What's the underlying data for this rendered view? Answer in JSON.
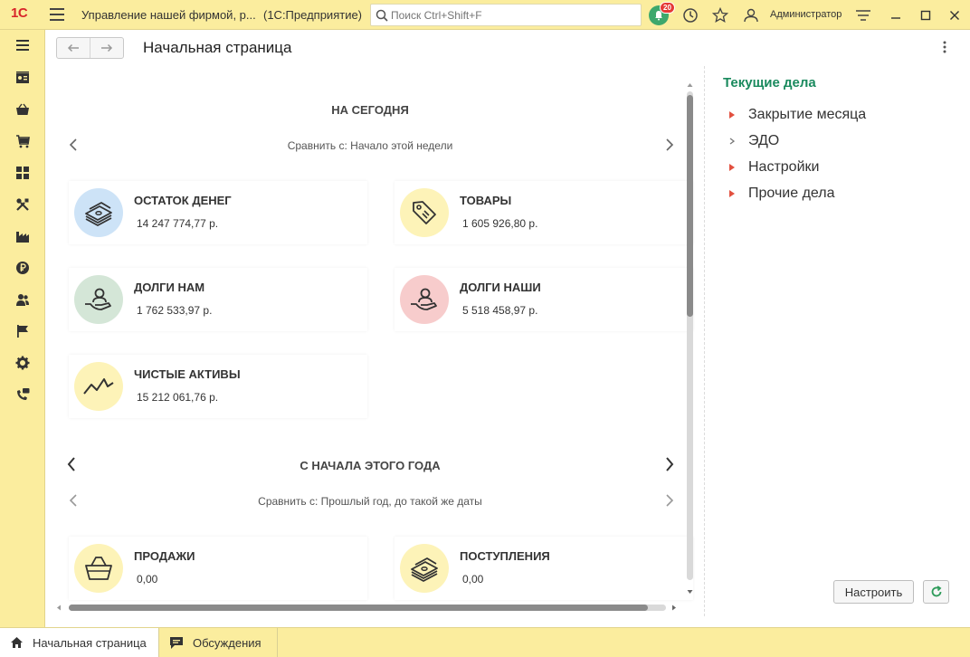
{
  "app": {
    "logo": "1С",
    "title": "Управление нашей фирмой, р...",
    "subtitle": "(1С:Предприятие)",
    "search_placeholder": "Поиск Ctrl+Shift+F",
    "notification_count": "20",
    "user_name": "Администратор"
  },
  "leftnav": {
    "items": [
      {
        "icon": "menu-icon"
      },
      {
        "icon": "crm-card-icon"
      },
      {
        "icon": "basket-icon"
      },
      {
        "icon": "cart-icon"
      },
      {
        "icon": "grid-icon"
      },
      {
        "icon": "tools-icon"
      },
      {
        "icon": "factory-icon"
      },
      {
        "icon": "ruble-icon"
      },
      {
        "icon": "staff-icon"
      },
      {
        "icon": "flag-icon"
      },
      {
        "icon": "gear-icon"
      },
      {
        "icon": "phone-chat-icon"
      }
    ]
  },
  "page": {
    "title": "Начальная страница"
  },
  "today": {
    "header": "НА СЕГОДНЯ",
    "compare": "Сравнить с: Начало этой недели",
    "cards": [
      {
        "title": "ОСТАТОК ДЕНЕГ",
        "value": "14 247 774,77 р.",
        "icon": "money-stack-icon",
        "color": "#cde3f7"
      },
      {
        "title": "ТОВАРЫ",
        "value": "1 605 926,80 р.",
        "icon": "price-tag-icon",
        "color": "#fdf3b8"
      },
      {
        "title": "ДОЛГИ НАМ",
        "value": "1 762 533,97 р.",
        "icon": "hand-person-icon",
        "color": "#d4e6d7"
      },
      {
        "title": "ДОЛГИ НАШИ",
        "value": "5 518 458,97 р.",
        "icon": "hand-person-icon",
        "color": "#f7cccc"
      },
      {
        "title": "ЧИСТЫЕ АКТИВЫ",
        "value": "15 212 061,76 р.",
        "icon": "trend-line-icon",
        "color": "#fdf3b8"
      }
    ]
  },
  "year": {
    "header": "С НАЧАЛА ЭТОГО ГОДА",
    "compare": "Сравнить с: Прошлый год, до такой же даты",
    "cards": [
      {
        "title": "ПРОДАЖИ",
        "value": "0,00",
        "icon": "basket-icon",
        "color": "#fdf3b8"
      },
      {
        "title": "ПОСТУПЛЕНИЯ",
        "value": "0,00",
        "icon": "money-stack-icon",
        "color": "#fdf3b8"
      }
    ]
  },
  "tasks": {
    "title": "Текущие дела",
    "items": [
      {
        "label": "Закрытие месяца",
        "expanded_marker": "red"
      },
      {
        "label": "ЭДО",
        "expanded_marker": "gray"
      },
      {
        "label": "Настройки",
        "expanded_marker": "red"
      },
      {
        "label": "Прочие дела",
        "expanded_marker": "red"
      }
    ],
    "setup_button": "Настроить"
  },
  "tabs": [
    {
      "label": "Начальная страница",
      "icon": "home-icon",
      "active": true
    },
    {
      "label": "Обсуждения",
      "icon": "chat-icon",
      "active": false
    }
  ],
  "colors": {
    "chrome": "#fbed9e",
    "accent_green": "#1a8a5e",
    "marker_red": "#e2503f"
  }
}
